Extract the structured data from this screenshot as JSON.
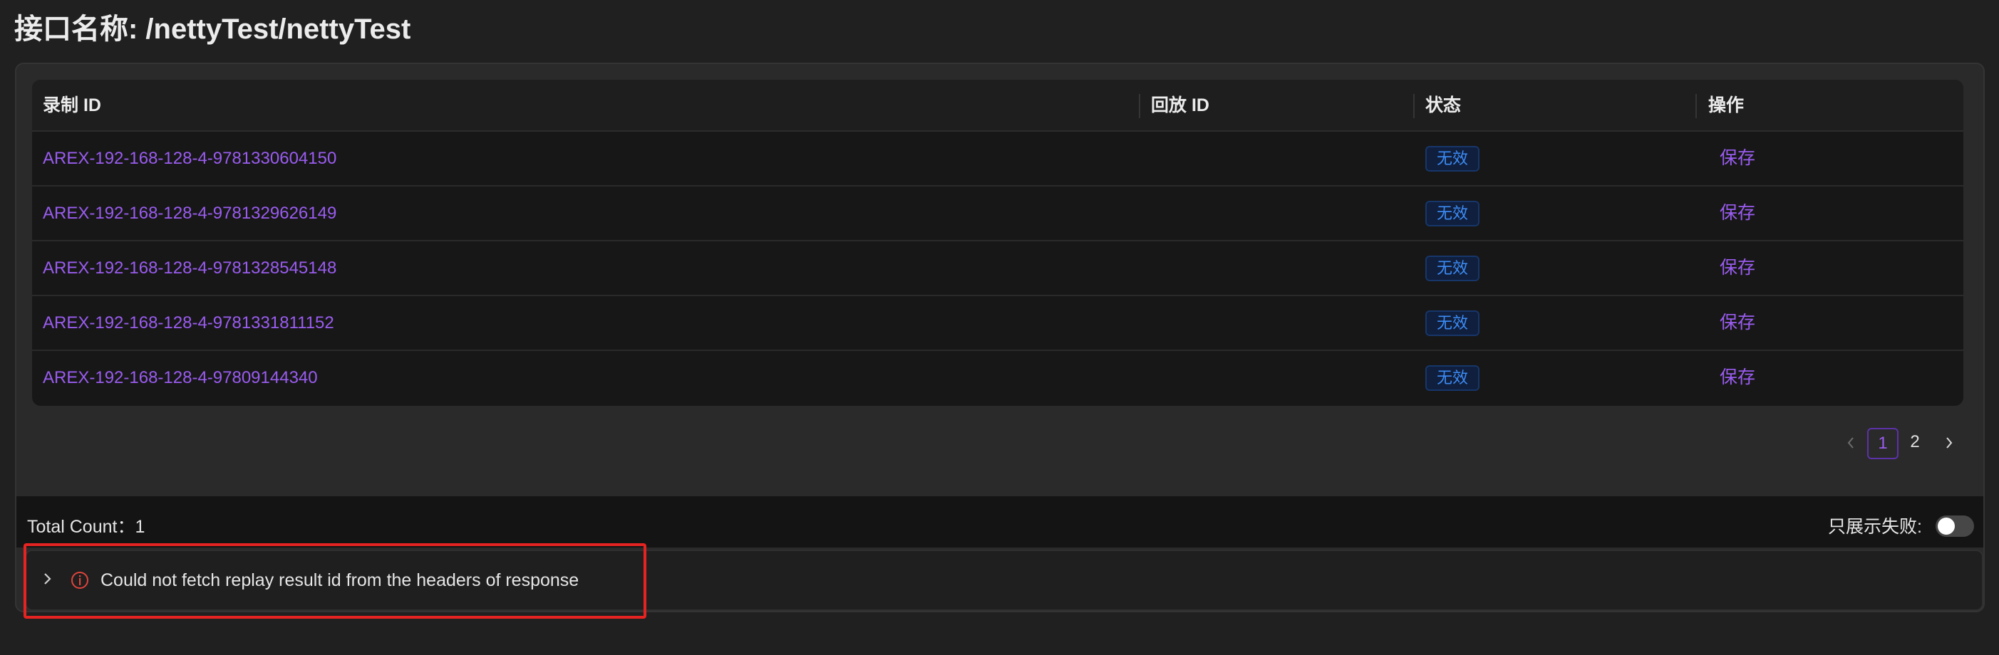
{
  "page": {
    "title": "接口名称: /nettyTest/nettyTest"
  },
  "table": {
    "columns": {
      "record_id": "录制 ID",
      "replay_id": "回放 ID",
      "status": "状态",
      "action": "操作"
    },
    "rows": [
      {
        "record_id": "AREX-192-168-128-4-9781330604150",
        "replay_id": "",
        "status": "无效",
        "action": "保存"
      },
      {
        "record_id": "AREX-192-168-128-4-9781329626149",
        "replay_id": "",
        "status": "无效",
        "action": "保存"
      },
      {
        "record_id": "AREX-192-168-128-4-9781328545148",
        "replay_id": "",
        "status": "无效",
        "action": "保存"
      },
      {
        "record_id": "AREX-192-168-128-4-9781331811152",
        "replay_id": "",
        "status": "无效",
        "action": "保存"
      },
      {
        "record_id": "AREX-192-168-128-4-97809144340",
        "replay_id": "",
        "status": "无效",
        "action": "保存"
      }
    ]
  },
  "pagination": {
    "pages": [
      "1",
      "2"
    ],
    "current": "1"
  },
  "footer": {
    "total_count": "Total Count：1",
    "only_failed_label": "只展示失败:",
    "only_failed_enabled": false
  },
  "error_panel": {
    "message": "Could not fetch replay result id from the headers of response",
    "collapsed": true
  },
  "colors": {
    "accent": "#9a5cf0",
    "status_tag": "#3d8cf7",
    "error": "#e52421",
    "background": "#202020"
  },
  "icons": {
    "pager_prev": "chevron-left-icon",
    "pager_next": "chevron-right-icon",
    "collapse": "chevron-right-icon",
    "error": "info-circle-icon"
  }
}
